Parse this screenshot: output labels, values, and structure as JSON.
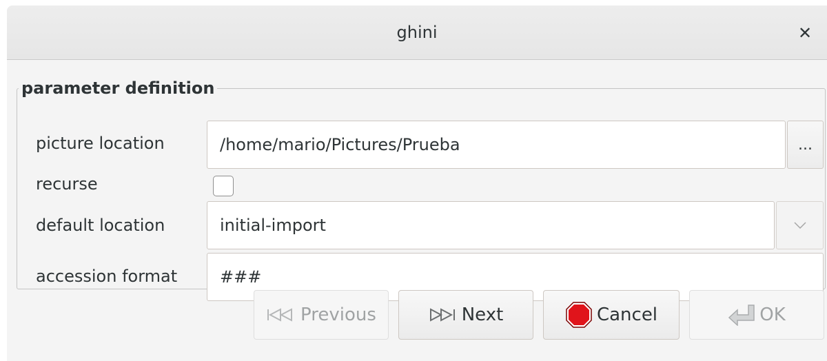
{
  "window": {
    "title": "ghini"
  },
  "group": {
    "legend": "parameter definition"
  },
  "fields": {
    "picture_location": {
      "label": "picture location",
      "value": "/home/mario/Pictures/Prueba",
      "browse_label": "..."
    },
    "recurse": {
      "label": "recurse",
      "checked": false
    },
    "default_location": {
      "label": "default location",
      "value": "initial-import"
    },
    "accession_format": {
      "label": "accession format",
      "value": "###"
    }
  },
  "buttons": {
    "previous": {
      "label": "Previous",
      "icon": "skip-backward-icon",
      "enabled": false
    },
    "next": {
      "label": "Next",
      "icon": "skip-forward-icon",
      "enabled": true
    },
    "cancel": {
      "label": "Cancel",
      "icon": "stop-icon",
      "enabled": true
    },
    "ok": {
      "label": "OK",
      "icon": "enter-arrow-icon",
      "enabled": false
    }
  },
  "colors": {
    "stop_red": "#e0141b",
    "disabled_text": "#a0a3a4"
  }
}
